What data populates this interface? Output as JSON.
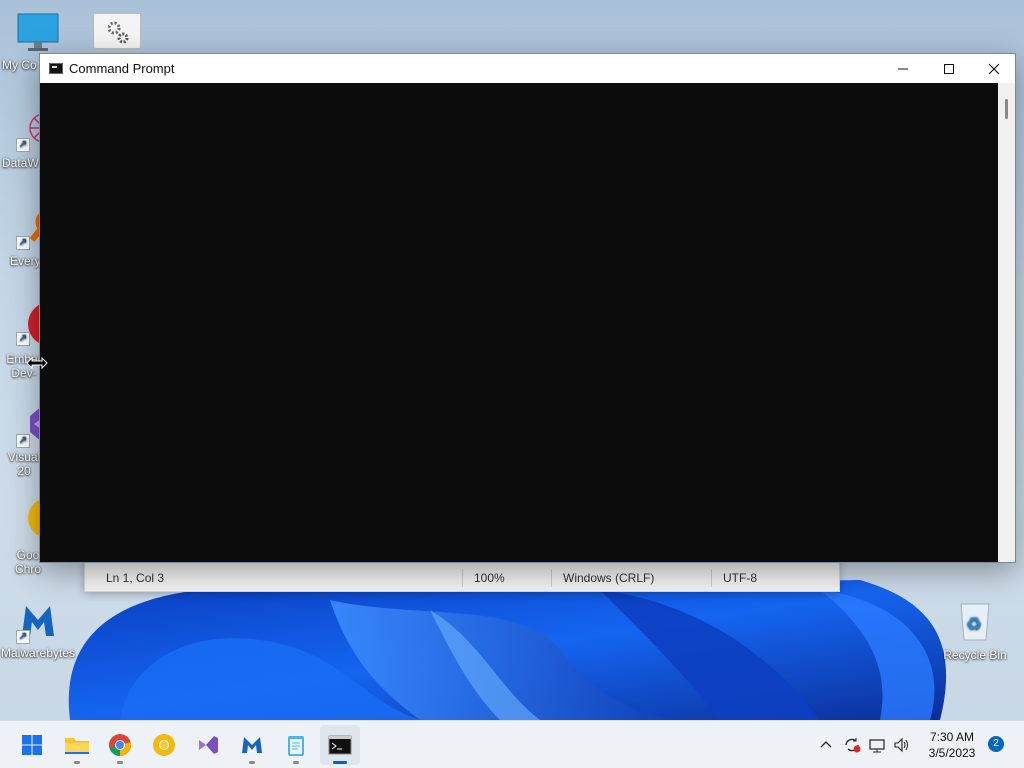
{
  "desktop": {
    "icons": [
      {
        "label": "My Co",
        "icon": "monitor-icon"
      },
      {
        "label": "DataW",
        "icon": "datawarrior-icon"
      },
      {
        "label": "Every",
        "icon": "everything-search-icon"
      },
      {
        "label": "Embar Dev-",
        "icon": "embarcadero-devcpp-icon"
      },
      {
        "label": "Visual 20",
        "icon": "visual-studio-icon"
      },
      {
        "label": "Goo Chro",
        "icon": "google-chrome-icon"
      },
      {
        "label": "Malwarebytes",
        "icon": "malwarebytes-icon"
      },
      {
        "label": "Recycle Bin",
        "icon": "recycle-bin-icon"
      }
    ]
  },
  "cmd_window": {
    "title": "Command Prompt",
    "buttons": {
      "minimize": "minimize-icon",
      "maximize": "maximize-icon",
      "close": "close-icon"
    }
  },
  "notepad_status": {
    "position": "Ln 1, Col 3",
    "zoom": "100%",
    "line_ending": "Windows (CRLF)",
    "encoding": "UTF-8"
  },
  "taskbar": {
    "apps": [
      {
        "name": "start",
        "icon": "windows-start-icon"
      },
      {
        "name": "file-explorer",
        "icon": "folder-icon"
      },
      {
        "name": "chrome",
        "icon": "chrome-icon"
      },
      {
        "name": "chrome-canary",
        "icon": "chrome-canary-icon"
      },
      {
        "name": "visual-studio",
        "icon": "visual-studio-icon"
      },
      {
        "name": "malwarebytes",
        "icon": "malwarebytes-icon"
      },
      {
        "name": "notepad",
        "icon": "notepad-icon"
      },
      {
        "name": "command-prompt",
        "icon": "terminal-icon"
      }
    ],
    "clock": {
      "time": "7:30 AM",
      "date": "3/5/2023"
    },
    "notification_count": "2"
  },
  "colors": {
    "console_bg": "#0c0c0c",
    "accent": "#0067c0"
  }
}
